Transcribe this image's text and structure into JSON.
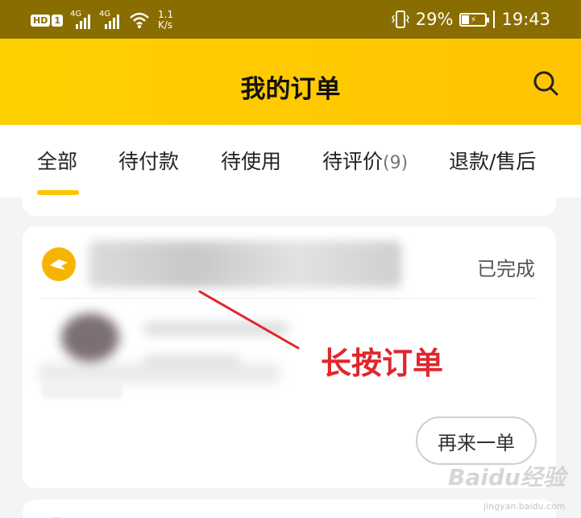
{
  "status_bar": {
    "hd": "HD",
    "hd_sub": "1",
    "signal1": "4G",
    "signal2": "4G",
    "speed_value": "1.1",
    "speed_unit": "K/s",
    "battery": "29%",
    "time": "19:43"
  },
  "header": {
    "title": "我的订单"
  },
  "tabs": [
    {
      "label": "全部",
      "active": true
    },
    {
      "label": "待付款"
    },
    {
      "label": "待使用"
    },
    {
      "label": "待评价",
      "count": "(9)"
    },
    {
      "label": "退款/售后"
    }
  ],
  "order": {
    "status": "已完成",
    "reorder_label": "再来一单"
  },
  "annotation": {
    "text": "长按订单"
  },
  "watermark": {
    "text": "Baidu经验",
    "sub": "jingyan.baidu.com"
  },
  "colors": {
    "accent": "#ffc400",
    "annotation": "#e0262d",
    "status_bar": "#8a6d00"
  }
}
